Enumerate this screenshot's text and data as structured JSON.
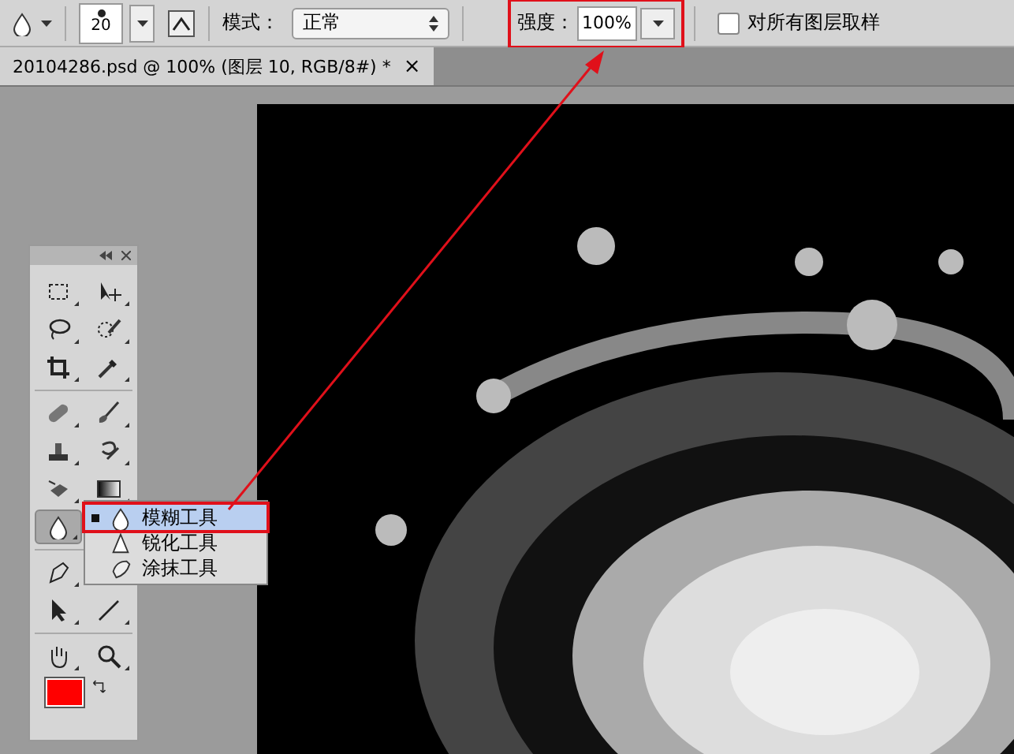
{
  "options_bar": {
    "brush_size": "20",
    "mode_label": "模式：",
    "mode_value": "正常",
    "strength_label": "强度：",
    "strength_value": "100%",
    "sample_all_layers": {
      "label": "对所有图层取样",
      "checked": false
    }
  },
  "document_tab": {
    "title": "20104286.psd @ 100% (图层 10, RGB/8#) *",
    "close": "×"
  },
  "tools_panel": {
    "tools": [
      {
        "kind": "marquee",
        "selected": false
      },
      {
        "kind": "move",
        "selected": false
      },
      {
        "kind": "lasso",
        "selected": false
      },
      {
        "kind": "quick-select",
        "selected": false
      },
      {
        "kind": "crop",
        "selected": false
      },
      {
        "kind": "eyedropper",
        "selected": false
      },
      {
        "kind": "divider"
      },
      {
        "kind": "healing",
        "selected": false
      },
      {
        "kind": "brush",
        "selected": false
      },
      {
        "kind": "stamp",
        "selected": false
      },
      {
        "kind": "history-brush",
        "selected": false
      },
      {
        "kind": "eraser",
        "selected": false
      },
      {
        "kind": "gradient",
        "selected": false
      },
      {
        "kind": "blur",
        "selected": true
      },
      {
        "kind": "empty"
      },
      {
        "kind": "divider"
      },
      {
        "kind": "pen",
        "selected": false
      },
      {
        "kind": "empty"
      },
      {
        "kind": "path-select",
        "selected": false
      },
      {
        "kind": "line",
        "selected": false
      },
      {
        "kind": "divider"
      },
      {
        "kind": "hand",
        "selected": false
      },
      {
        "kind": "zoom",
        "selected": false
      }
    ],
    "foreground": {
      "color": "#ff0000"
    }
  },
  "flyout": {
    "items": [
      {
        "kind": "blur",
        "label": "模糊工具",
        "selected": true
      },
      {
        "kind": "sharpen",
        "label": "锐化工具",
        "selected": false
      },
      {
        "kind": "smudge",
        "label": "涂抹工具",
        "selected": false
      }
    ]
  }
}
